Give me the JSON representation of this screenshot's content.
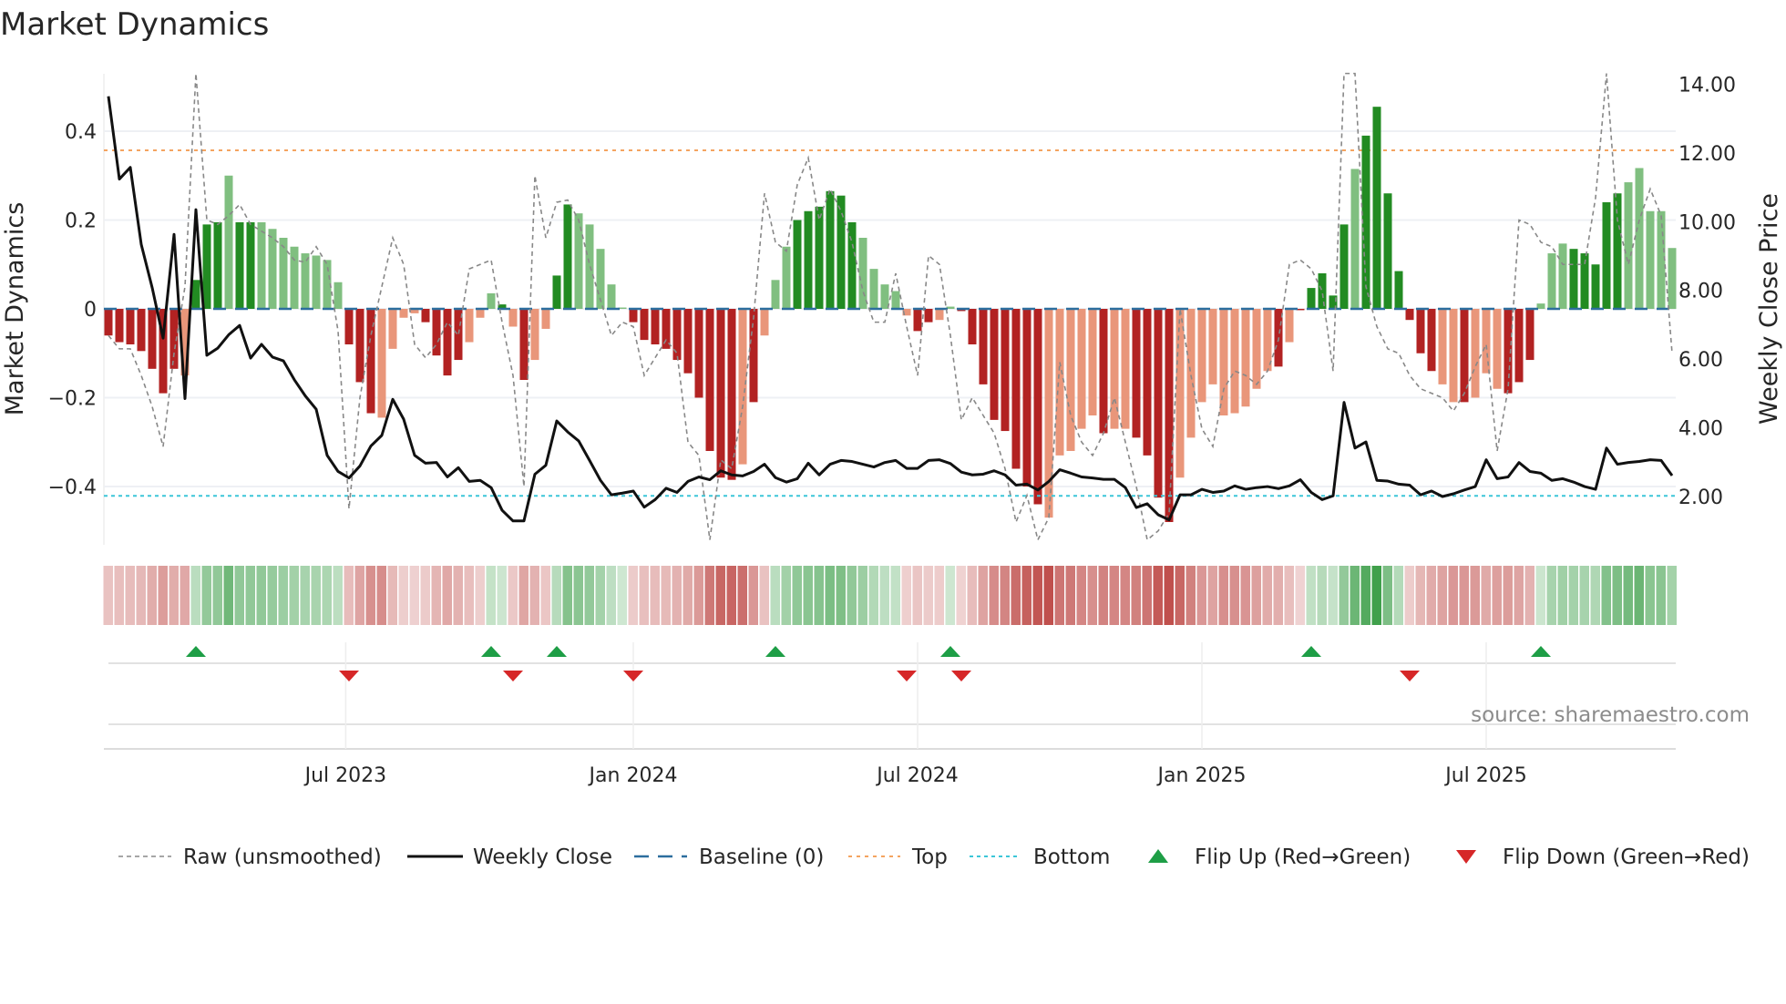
{
  "chart_data": {
    "type": "bar",
    "title": "Market Dynamics",
    "ylabel": "Market Dynamics",
    "ylabel_right": "Weekly Close Price",
    "ylim": [
      -0.53,
      0.53
    ],
    "ylim_right": [
      0.58,
      14.31
    ],
    "yticks": [
      {
        "v": 0.4,
        "label": "0.4"
      },
      {
        "v": 0.2,
        "label": "0.2"
      },
      {
        "v": 0,
        "label": "0"
      },
      {
        "v": -0.2,
        "label": "−0.2"
      },
      {
        "v": -0.4,
        "label": "−0.4"
      }
    ],
    "yticks_right": [
      {
        "v": 14,
        "label": "14.00"
      },
      {
        "v": 12,
        "label": "12.00"
      },
      {
        "v": 10,
        "label": "10.00"
      },
      {
        "v": 8,
        "label": "8.00"
      },
      {
        "v": 6,
        "label": "6.00"
      },
      {
        "v": 4,
        "label": "4.00"
      },
      {
        "v": 2,
        "label": "2.00"
      }
    ],
    "xticks": [
      {
        "week_index": 21.7,
        "label": "Jul 2023"
      },
      {
        "week_index": 48,
        "label": "Jan 2024"
      },
      {
        "week_index": 74,
        "label": "Jul 2024"
      },
      {
        "week_index": 100,
        "label": "Jan 2025"
      },
      {
        "week_index": 126,
        "label": "Jul 2025"
      }
    ],
    "top_level": 0.357,
    "bottom_level": -0.421,
    "baseline": 0,
    "bars": [
      -0.06,
      -0.075,
      -0.08,
      -0.095,
      -0.135,
      -0.19,
      -0.135,
      -0.15,
      0.065,
      0.19,
      0.195,
      0.3,
      0.195,
      0.195,
      0.195,
      0.18,
      0.16,
      0.14,
      0.125,
      0.12,
      0.11,
      0.06,
      -0.08,
      -0.165,
      -0.235,
      -0.245,
      -0.09,
      -0.02,
      -0.01,
      -0.03,
      -0.105,
      -0.15,
      -0.115,
      -0.075,
      -0.02,
      0.035,
      0.01,
      -0.04,
      -0.16,
      -0.115,
      -0.045,
      0.075,
      0.235,
      0.215,
      0.19,
      0.135,
      0.055,
      0.003,
      -0.03,
      -0.07,
      -0.08,
      -0.09,
      -0.115,
      -0.145,
      -0.2,
      -0.32,
      -0.38,
      -0.385,
      -0.35,
      -0.21,
      -0.06,
      0.065,
      0.14,
      0.2,
      0.22,
      0.23,
      0.265,
      0.255,
      0.195,
      0.16,
      0.09,
      0.055,
      0.04,
      -0.015,
      -0.05,
      -0.03,
      -0.025,
      0.005,
      -0.005,
      -0.08,
      -0.17,
      -0.25,
      -0.275,
      -0.36,
      -0.4,
      -0.44,
      -0.47,
      -0.33,
      -0.32,
      -0.27,
      -0.24,
      -0.28,
      -0.27,
      -0.27,
      -0.29,
      -0.33,
      -0.425,
      -0.48,
      -0.38,
      -0.29,
      -0.21,
      -0.17,
      -0.24,
      -0.235,
      -0.22,
      -0.18,
      -0.14,
      -0.13,
      -0.075,
      -0.003,
      0.047,
      0.08,
      0.03,
      0.19,
      0.315,
      0.39,
      0.455,
      0.26,
      0.085,
      -0.025,
      -0.1,
      -0.14,
      -0.17,
      -0.21,
      -0.21,
      -0.2,
      -0.145,
      -0.18,
      -0.19,
      -0.165,
      -0.115,
      0.012,
      0.125,
      0.147,
      0.135,
      0.125,
      0.1,
      0.24,
      0.26,
      0.285,
      0.317,
      0.22,
      0.22,
      0.137
    ],
    "bar_shade": "dddddddldddlddlllllllldddllllddddllldldllddlllllddddddddddldlllddddddlllllddllddddddddllllldllddddllllllllldldddddldddddddlldllldddllldddddlll",
    "raw": [
      -0.06,
      -0.09,
      -0.09,
      -0.15,
      -0.22,
      -0.31,
      -0.1,
      0.05,
      0.53,
      0.2,
      0.19,
      0.21,
      0.235,
      0.19,
      0.175,
      0.16,
      0.14,
      0.11,
      0.105,
      0.14,
      0.1,
      -0.05,
      -0.45,
      -0.2,
      -0.06,
      0.05,
      0.16,
      0.1,
      -0.08,
      -0.11,
      -0.08,
      -0.03,
      -0.06,
      0.09,
      0.1,
      0.11,
      -0.03,
      -0.15,
      -0.4,
      0.3,
      0.16,
      0.24,
      0.245,
      0.2,
      0.1,
      0.02,
      -0.06,
      -0.03,
      -0.04,
      -0.15,
      -0.11,
      -0.07,
      -0.1,
      -0.3,
      -0.33,
      -0.52,
      -0.34,
      -0.36,
      -0.22,
      -0.02,
      0.26,
      0.15,
      0.13,
      0.28,
      0.34,
      0.2,
      0.27,
      0.22,
      0.15,
      0.04,
      -0.03,
      -0.03,
      0.08,
      -0.04,
      -0.15,
      0.12,
      0.1,
      -0.06,
      -0.25,
      -0.2,
      -0.24,
      -0.28,
      -0.36,
      -0.48,
      -0.42,
      -0.52,
      -0.47,
      -0.12,
      -0.24,
      -0.3,
      -0.33,
      -0.28,
      -0.2,
      -0.3,
      -0.4,
      -0.52,
      -0.5,
      -0.46,
      0.0,
      -0.15,
      -0.27,
      -0.31,
      -0.18,
      -0.14,
      -0.15,
      -0.17,
      -0.14,
      -0.07,
      0.1,
      0.11,
      0.09,
      0.04,
      -0.14,
      0.53,
      0.53,
      0.05,
      -0.04,
      -0.09,
      -0.1,
      -0.15,
      -0.18,
      -0.19,
      -0.2,
      -0.23,
      -0.19,
      -0.13,
      -0.08,
      -0.32,
      -0.18,
      0.2,
      0.19,
      0.15,
      0.14,
      0.1,
      0.1,
      0.1,
      0.25,
      0.53,
      0.2,
      0.1,
      0.2,
      0.27,
      0.21,
      -0.1
    ],
    "weekly_close": [
      13.65,
      11.24,
      11.58,
      9.34,
      8.08,
      6.61,
      9.63,
      4.85,
      10.35,
      6.11,
      6.32,
      6.71,
      6.98,
      6.03,
      6.43,
      6.06,
      5.95,
      5.4,
      4.93,
      4.54,
      3.2,
      2.73,
      2.54,
      2.89,
      3.47,
      3.78,
      4.83,
      4.25,
      3.2,
      2.97,
      2.99,
      2.57,
      2.84,
      2.44,
      2.47,
      2.26,
      1.6,
      1.29,
      1.29,
      2.65,
      2.91,
      4.2,
      3.88,
      3.62,
      3.05,
      2.47,
      2.05,
      2.1,
      2.16,
      1.69,
      1.91,
      2.24,
      2.12,
      2.44,
      2.57,
      2.49,
      2.75,
      2.63,
      2.6,
      2.73,
      2.94,
      2.55,
      2.42,
      2.52,
      2.97,
      2.63,
      2.94,
      3.05,
      3.02,
      2.94,
      2.86,
      2.99,
      3.05,
      2.82,
      2.82,
      3.05,
      3.07,
      2.96,
      2.71,
      2.63,
      2.65,
      2.75,
      2.63,
      2.33,
      2.36,
      2.19,
      2.44,
      2.78,
      2.68,
      2.57,
      2.54,
      2.5,
      2.5,
      2.26,
      1.68,
      1.79,
      1.47,
      1.32,
      2.05,
      2.05,
      2.21,
      2.12,
      2.16,
      2.31,
      2.21,
      2.26,
      2.29,
      2.23,
      2.31,
      2.49,
      2.12,
      1.91,
      2.02,
      4.74,
      3.41,
      3.59,
      2.47,
      2.45,
      2.36,
      2.33,
      2.05,
      2.16,
      2.0,
      2.08,
      2.19,
      2.29,
      3.07,
      2.52,
      2.57,
      2.99,
      2.73,
      2.68,
      2.47,
      2.52,
      2.42,
      2.29,
      2.21,
      3.41,
      2.94,
      2.99,
      3.02,
      3.07,
      3.05,
      2.61
    ],
    "flip_up_week_index": [
      8,
      35,
      41,
      61,
      77,
      110,
      131
    ],
    "flip_down_week_index": [
      22,
      37,
      48,
      73,
      78,
      119
    ],
    "legend_placement": "bottom",
    "legend": [
      {
        "key": "raw",
        "label": "Raw (unsmoothed)"
      },
      {
        "key": "close",
        "label": "Weekly Close"
      },
      {
        "key": "baseline",
        "label": "Baseline (0)"
      },
      {
        "key": "top",
        "label": "Top"
      },
      {
        "key": "bottom",
        "label": "Bottom"
      },
      {
        "key": "flip_up",
        "label": "Flip Up (Red→Green)"
      },
      {
        "key": "flip_down",
        "label": "Flip Down (Green→Red)"
      }
    ],
    "source": "source: sharemaestro.com"
  },
  "colors": {
    "pos_strong": "#228B22",
    "pos_weak": "#80BF80",
    "neg_strong": "#B22222",
    "neg_weak": "#E9967A",
    "raw": "#888888",
    "close": "#111111",
    "baseline": "#2C6E9E",
    "top": "#F4A460",
    "bottom": "#3CC6D8",
    "flip_up": "#1E9E46",
    "flip_down": "#D62728",
    "heat_pos": "#3E9F4A",
    "heat_neg": "#C0504D"
  }
}
